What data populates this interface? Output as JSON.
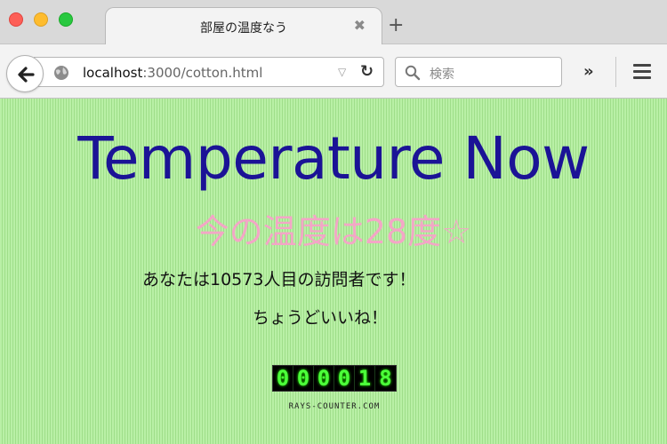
{
  "window": {
    "tab_title": "部屋の温度なう",
    "tab_close": "✖",
    "new_tab": "+"
  },
  "toolbar": {
    "url_host": "localhost",
    "url_path": ":3000/cotton.html",
    "search_placeholder": "検索",
    "overflow": "»",
    "reload": "↻"
  },
  "page": {
    "heading": "Temperature Now",
    "temperature_text": "今の温度は28度☆",
    "visitor_text": "あなたは10573人目の訪問者です！",
    "nice_text": "ちょうどいいね！"
  },
  "counter": {
    "digits": [
      "0",
      "0",
      "0",
      "0",
      "1",
      "8"
    ],
    "credit": "RAYS-COUNTER.COM"
  },
  "colors": {
    "heading": "#1b1396",
    "temperature": "#f3a6c6",
    "background": "#b9f0a6",
    "counter_digit": "#4cff3a"
  }
}
